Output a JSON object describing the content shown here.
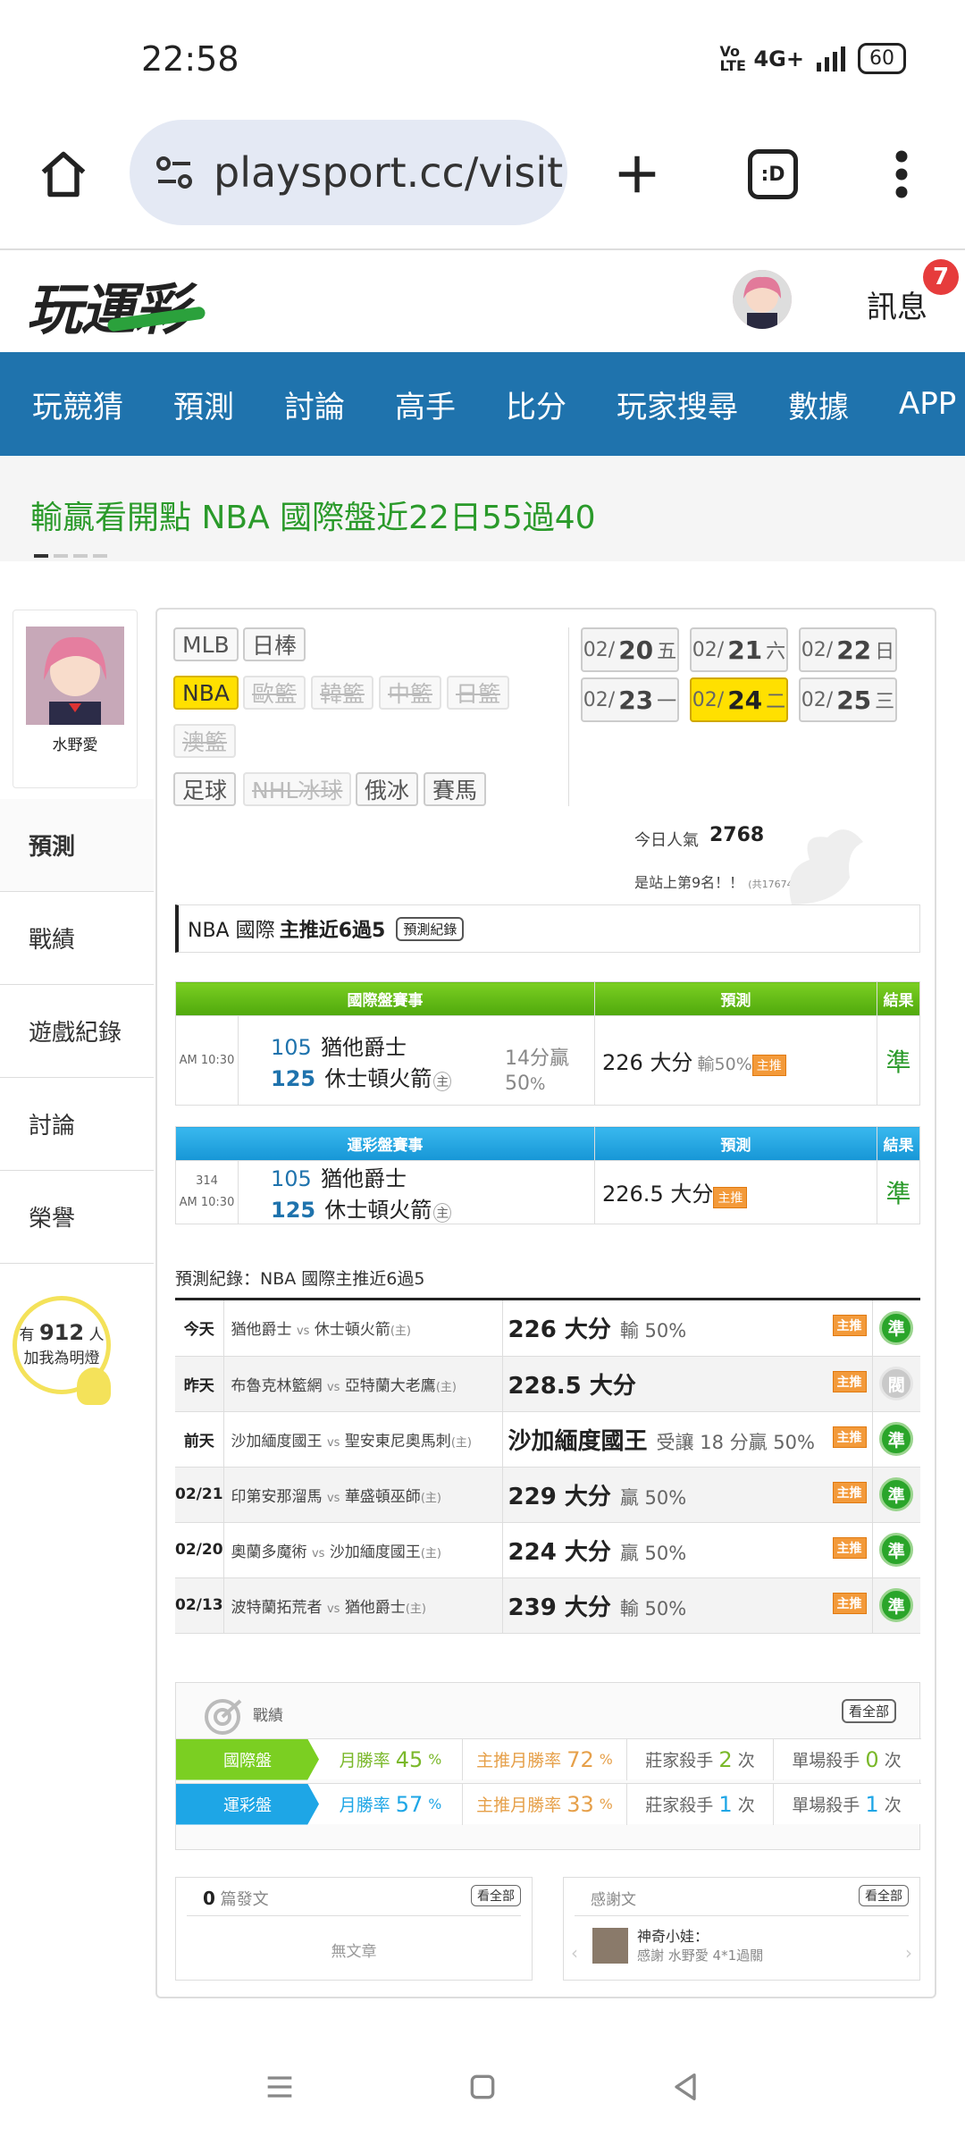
{
  "status": {
    "time": "22:58",
    "network": "4G+",
    "volte": "Vo LTE",
    "battery": "60"
  },
  "browser": {
    "url": "playsport.cc/visit"
  },
  "header": {
    "logo": "玩運彩",
    "messages_label": "訊息",
    "messages_count": "7"
  },
  "nav": {
    "items": [
      "玩競猜",
      "預測",
      "討論",
      "高手",
      "比分",
      "玩家搜尋",
      "數據",
      "APP"
    ]
  },
  "ticker": {
    "text": "輸贏看開點 NBA 國際盤近22日55過40"
  },
  "profile": {
    "name": "水野愛"
  },
  "sidebar": {
    "items": [
      "預測",
      "戰績",
      "遊戲紀錄",
      "討論",
      "榮譽"
    ],
    "active": "預測"
  },
  "fans": {
    "prefix": "有",
    "count": "912",
    "suffix": "人",
    "line2": "加我為明燈"
  },
  "leagues": {
    "row1": [
      "MLB",
      "日棒"
    ],
    "row2": [
      "NBA",
      "歐籃",
      "韓籃",
      "中籃",
      "日籃"
    ],
    "row3": [
      "澳籃"
    ],
    "row4": [
      "足球",
      "NHL冰球",
      "俄冰",
      "賽馬"
    ],
    "active": "NBA"
  },
  "dates": [
    {
      "md": "02/",
      "d": "20",
      "w": "五"
    },
    {
      "md": "02/",
      "d": "21",
      "w": "六"
    },
    {
      "md": "02/",
      "d": "22",
      "w": "日"
    },
    {
      "md": "02/",
      "d": "23",
      "w": "一"
    },
    {
      "md": "02/",
      "d": "24",
      "w": "二"
    },
    {
      "md": "02/",
      "d": "25",
      "w": "三"
    }
  ],
  "popularity": {
    "label": "今日人氣",
    "value": "2768",
    "rank_text": "是站上第9名！！",
    "total": "(共17674人)"
  },
  "section": {
    "title_prefix": "NBA 國際",
    "title_bold": "主推近6過5",
    "record_button": "預測紀錄"
  },
  "intl_table": {
    "headers": [
      "國際盤賽事",
      "預測",
      "結果"
    ],
    "time": "AM 10:30",
    "team1_score": "105",
    "team1": "猶他爵士",
    "team2_score": "125",
    "team2": "休士頓火箭",
    "host": "主",
    "margin": "14分贏",
    "margin_pct": "50",
    "pct_sign": "%",
    "pick": "226 大分",
    "pick_note": "輸50%",
    "badge": "主推",
    "result": "準"
  },
  "lottery_table": {
    "headers": [
      "運彩盤賽事",
      "預測",
      "結果"
    ],
    "game_no": "314",
    "time": "AM 10:30",
    "team1_score": "105",
    "team1": "猶他爵士",
    "team2_score": "125",
    "team2": "休士頓火箭",
    "host": "主",
    "pick": "226.5 大分",
    "badge": "主推",
    "result": "準"
  },
  "history": {
    "title": "預測紀錄：NBA 國際主推近6過5",
    "vs": "vs",
    "host": "(主)",
    "rows": [
      {
        "day": "今天",
        "away": "猶他爵士",
        "home": "休士頓火箭",
        "pick": "226 大分",
        "note": "輸 50%",
        "badge": "主推",
        "result": "準",
        "grey": false
      },
      {
        "day": "昨天",
        "away": "布魯克林籃網",
        "home": "亞特蘭大老鷹",
        "pick": "228.5 大分",
        "note": "",
        "badge": "主推",
        "result": "閥",
        "grey": true
      },
      {
        "day": "前天",
        "away": "沙加緬度國王",
        "home": "聖安東尼奧馬刺",
        "pick": "沙加緬度國王",
        "note": "受讓 18 分贏 50%",
        "badge": "主推",
        "result": "準",
        "grey": false
      },
      {
        "day": "02/21",
        "away": "印第安那溜馬",
        "home": "華盛頓巫師",
        "pick": "229 大分",
        "note": "贏 50%",
        "badge": "主推",
        "result": "準",
        "grey": false
      },
      {
        "day": "02/20",
        "away": "奧蘭多魔術",
        "home": "沙加緬度國王",
        "pick": "224 大分",
        "note": "贏 50%",
        "badge": "主推",
        "result": "準",
        "grey": false
      },
      {
        "day": "02/13",
        "away": "波特蘭拓荒者",
        "home": "猶他爵士",
        "pick": "239 大分",
        "note": "輸 50%",
        "badge": "主推",
        "result": "準",
        "grey": false
      }
    ]
  },
  "stats": {
    "title": "戰績",
    "view_all": "看全部",
    "rows": [
      {
        "label": "國際盤",
        "month_label": "月勝率",
        "month": "45",
        "main_label": "主推月勝率",
        "main": "72",
        "pct": "%",
        "dealer_label": "莊家殺手",
        "dealer": "2",
        "single_label": "單場殺手",
        "single": "0",
        "unit": "次",
        "color": "#7bcf22"
      },
      {
        "label": "運彩盤",
        "month_label": "月勝率",
        "month": "57",
        "main_label": "主推月勝率",
        "main": "33",
        "pct": "%",
        "dealer_label": "莊家殺手",
        "dealer": "1",
        "single_label": "單場殺手",
        "single": "1",
        "unit": "次",
        "color": "#1ea6e6"
      }
    ]
  },
  "posts": {
    "count": "0",
    "label": "篇發文",
    "view_all": "看全部",
    "empty": "無文章"
  },
  "thanks": {
    "label": "感謝文",
    "view_all": "看全部",
    "user": "神奇小娃：",
    "text": "感謝 水野愛 4*1過關"
  }
}
